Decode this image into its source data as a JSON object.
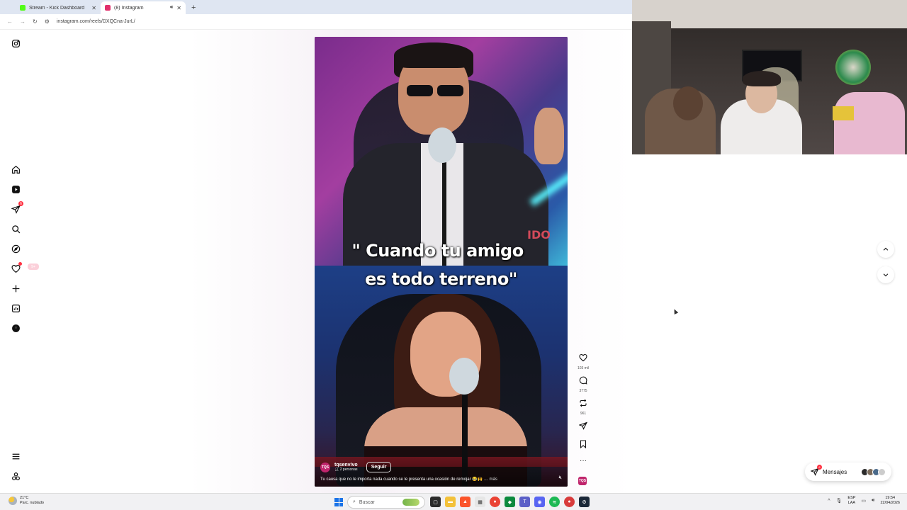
{
  "browser": {
    "tabs": [
      {
        "title": "Stream - Kick Dashboard",
        "favicon_color": "#53fc18",
        "active": false
      },
      {
        "title": "(8) Instagram",
        "favicon_color": "#e1306c",
        "active": true
      }
    ],
    "url": "instagram.com/reels/DXQCna-JurL/"
  },
  "sidebar": {
    "messages_badge": "6",
    "items": [
      {
        "icon": "instagram-icon"
      },
      {
        "icon": "home-icon"
      },
      {
        "icon": "reels-icon"
      },
      {
        "icon": "direct-messages-icon"
      },
      {
        "icon": "search-icon"
      },
      {
        "icon": "explore-icon"
      },
      {
        "icon": "notifications-heart-icon"
      },
      {
        "icon": "create-plus-icon"
      },
      {
        "icon": "dashboard-icon"
      },
      {
        "icon": "profile-avatar"
      },
      {
        "icon": "menu-icon"
      },
      {
        "icon": "threads-icon"
      }
    ],
    "notif_pill": "9+"
  },
  "reel": {
    "overlay_line1": "\" Cuando tu amigo",
    "overlay_line2": "es todo terreno\"",
    "desk_text": "IDO",
    "author": "tqsenvivo",
    "author_avatar_text": "TQS",
    "collab": "2 personas",
    "follow_label": "Seguir",
    "description": "Tu causa que no le importa nada cuando se le presenta una ocasión de remojar 😂🙌 …",
    "more_label": "más"
  },
  "actions": {
    "likes": "103 mil",
    "comments": "3775",
    "reposts": "961",
    "author_avatar_text": "TQS"
  },
  "messages": {
    "label": "Mensajes",
    "badge": "6"
  },
  "taskbar": {
    "weather_temp": "21°C",
    "weather_desc": "Parc. nublado",
    "search_placeholder": "Buscar",
    "lang_line1": "ESP",
    "lang_line2": "LAA",
    "time": "19:54",
    "date": "22/04/2026"
  }
}
